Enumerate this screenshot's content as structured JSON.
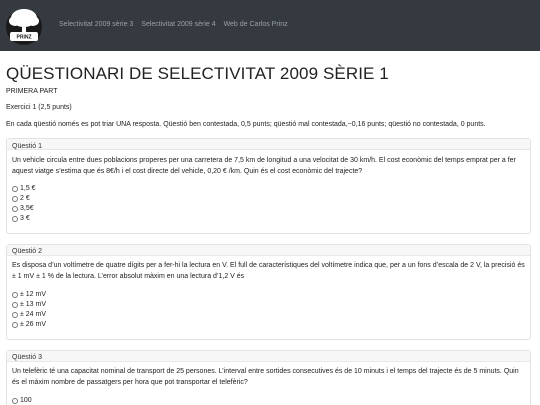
{
  "navbar": {
    "logo_text": "CARLOS PRINZ",
    "links": [
      "Selectivitat 2009 sèrie 3",
      "Selectivitat 2009 sèrie 4",
      "Web de Carlos Prinz"
    ]
  },
  "page": {
    "title": "QÜESTIONARI DE SELECTIVITAT 2009 SÈRIE 1",
    "section": "PRIMERA PART",
    "exercise": "Exercici 1 (2,5 punts)",
    "instructions": "En cada qüestió només es pot triar UNA resposta. Qüestió ben contestada, 0,5 punts; qüestió mal contestada,−0,16 punts; qüestió no contestada, 0 punts."
  },
  "questions": [
    {
      "label": "Qüestió 1",
      "text": "Un vehicle circula entre dues poblacions properes per una carretera de 7,5 km de longitud a una velocitat de 30 km/h. El cost econòmic del temps emprat per a fer aquest viatge s’estima que és 8€/h i el cost directe del vehicle, 0,20 € /km. Quin és el cost econòmic del trajecte?",
      "options": [
        "1,5 €",
        "2 €",
        "3,5€",
        "3 €"
      ]
    },
    {
      "label": "Qüestió 2",
      "text": "Es disposa d’un voltímetre de quatre dígits per a fer-hi la lectura en V. El full de característiques del voltímetre indica que, per a un fons d’escala de 2 V, la precisió és ± 1 mV ± 1 % de la lectura. L’error absolut màxim en una lectura d’1,2 V és",
      "options": [
        "± 12 mV",
        "± 13 mV",
        "± 24 mV",
        "± 26 mV"
      ]
    },
    {
      "label": "Qüestió 3",
      "text": "Un telefèric té una capacitat nominal de transport de 25 persones. L’interval entre sortides consecutives és de 10 minuts i el temps del trajecte és de 5 minuts. Quin és el màxim nombre de passatgers per hora que pot transportar el telefèric?",
      "options": [
        "100"
      ]
    }
  ]
}
